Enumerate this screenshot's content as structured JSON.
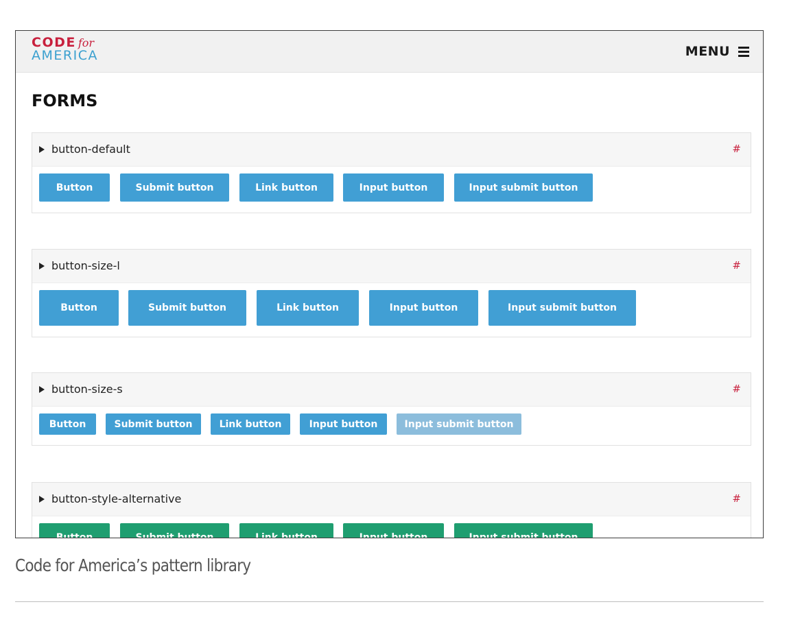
{
  "header": {
    "logo_code": "CODE",
    "logo_for": "for",
    "logo_america": "AMERICA",
    "menu_label": "MENU",
    "menu_icon": "hamburger-icon"
  },
  "page_title": "FORMS",
  "sections": [
    {
      "name": "button-default",
      "anchor": "#",
      "buttons": [
        "Button",
        "Submit button",
        "Link button",
        "Input button",
        "Input submit button"
      ]
    },
    {
      "name": "button-size-l",
      "anchor": "#",
      "buttons": [
        "Button",
        "Submit button",
        "Link button",
        "Input button",
        "Input submit button"
      ]
    },
    {
      "name": "button-size-s",
      "anchor": "#",
      "buttons": [
        "Button",
        "Submit button",
        "Link button",
        "Input button",
        "Input submit button"
      ]
    },
    {
      "name": "button-style-alternative",
      "anchor": "#",
      "buttons": [
        "Button",
        "Submit button",
        "Link button",
        "Input button",
        "Input submit button"
      ]
    }
  ],
  "caption": "Code for America’s pattern library",
  "colors": {
    "brand_red": "#c8203d",
    "brand_blue": "#3ba0cf",
    "button_blue": "#419fd4",
    "button_green": "#1f9e70",
    "button_disabled": "#8cbddc"
  }
}
